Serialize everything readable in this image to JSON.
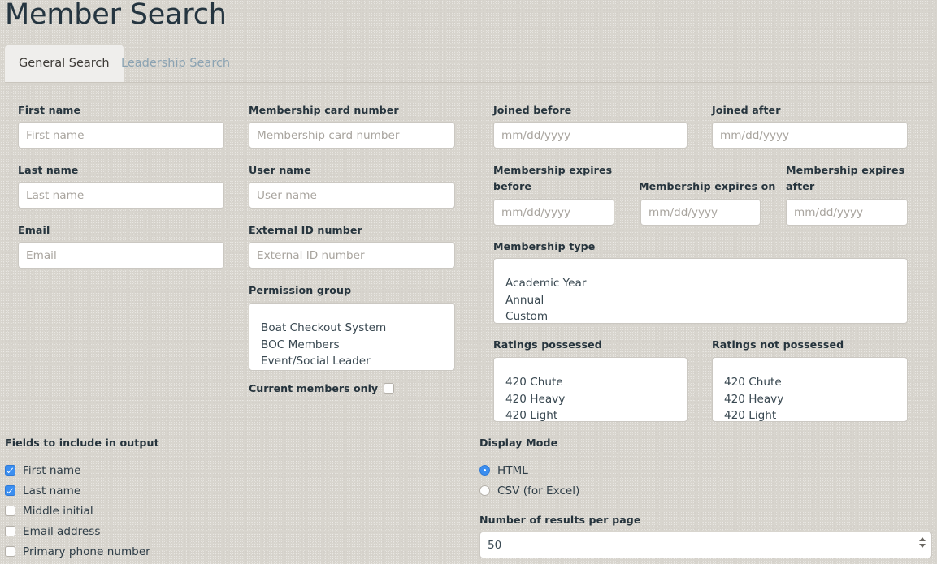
{
  "header": {
    "title": "Member Search"
  },
  "tabs": [
    {
      "label": "General Search",
      "active": true
    },
    {
      "label": "Leadership Search",
      "active": false
    }
  ],
  "columns": {
    "personal": {
      "first_name": {
        "label": "First name",
        "placeholder": "First name",
        "value": ""
      },
      "last_name": {
        "label": "Last name",
        "placeholder": "Last name",
        "value": ""
      },
      "email": {
        "label": "Email",
        "placeholder": "Email",
        "value": ""
      }
    },
    "identifiers": {
      "membership_card_number": {
        "label": "Membership card number",
        "placeholder": "Membership card number",
        "value": ""
      },
      "user_name": {
        "label": "User name",
        "placeholder": "User name",
        "value": ""
      },
      "external_id_number": {
        "label": "External ID number",
        "placeholder": "External ID number",
        "value": ""
      },
      "permission_group": {
        "label": "Permission group",
        "options": [
          "",
          "Boat Checkout System",
          "BOC Members",
          "Event/Social Leader"
        ]
      },
      "current_members_only": {
        "label": "Current members only",
        "checked": false
      }
    },
    "dates": {
      "joined_before": {
        "label": "Joined before",
        "placeholder": "mm/dd/yyyy",
        "value": ""
      },
      "joined_after": {
        "label": "Joined after",
        "placeholder": "mm/dd/yyyy",
        "value": ""
      },
      "membership_expires_before": {
        "label": "Membership expires before",
        "placeholder": "mm/dd/yyyy",
        "value": ""
      },
      "membership_expires_on": {
        "label": "Membership expires on",
        "placeholder": "mm/dd/yyyy",
        "value": ""
      },
      "membership_expires_after": {
        "label": "Membership expires after",
        "placeholder": "mm/dd/yyyy",
        "value": ""
      },
      "membership_type": {
        "label": "Membership type",
        "options": [
          "",
          "Academic Year",
          "Annual",
          "Custom"
        ]
      },
      "ratings_possessed": {
        "label": "Ratings possessed",
        "options": [
          "",
          "420 Chute",
          "420 Heavy",
          "420 Light"
        ]
      },
      "ratings_not_possessed": {
        "label": "Ratings not possessed",
        "options": [
          "",
          "420 Chute",
          "420 Heavy",
          "420 Light"
        ]
      }
    }
  },
  "output_fields": {
    "label": "Fields to include in output",
    "items": [
      {
        "label": "First name",
        "checked": true
      },
      {
        "label": "Last name",
        "checked": true
      },
      {
        "label": "Middle initial",
        "checked": false
      },
      {
        "label": "Email address",
        "checked": false
      },
      {
        "label": "Primary phone number",
        "checked": false
      }
    ]
  },
  "display_mode": {
    "label": "Display Mode",
    "options": [
      {
        "label": "HTML",
        "selected": true
      },
      {
        "label": "CSV (for Excel)",
        "selected": false
      }
    ]
  },
  "results_per_page": {
    "label": "Number of results per page",
    "value": "50"
  },
  "colors": {
    "page_background": "#d8d5ce",
    "accent": "#3b8ef0",
    "text": "#2b3a43",
    "inactive_tab_text": "#8ba3b3",
    "active_tab_background": "#efeeec",
    "input_background": "#ffffff",
    "input_border": "#cbc8c2",
    "placeholder": "#a8a49e"
  }
}
